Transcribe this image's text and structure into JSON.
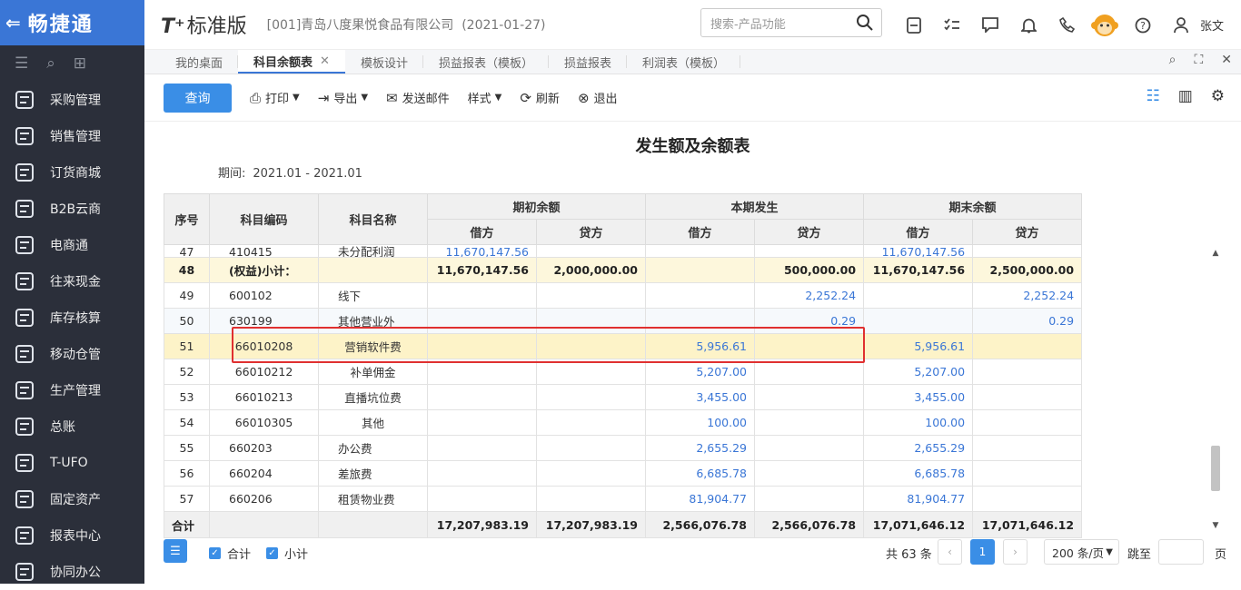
{
  "app": {
    "logo_text": "畅捷通",
    "brand": "T",
    "brand_suffix": "标准版",
    "company": "[001]青岛八度果悦食品有限公司",
    "date": "(2021-01-27)",
    "user": "张文"
  },
  "search": {
    "placeholder": "搜索-产品功能"
  },
  "sidebar": {
    "items": [
      {
        "label": "采购管理",
        "icon": "cart-icon"
      },
      {
        "label": "销售管理",
        "icon": "chart-icon"
      },
      {
        "label": "订货商城",
        "icon": "store-icon"
      },
      {
        "label": "B2B云商",
        "icon": "b2b-icon"
      },
      {
        "label": "电商通",
        "icon": "ecommerce-icon"
      },
      {
        "label": "往来现金",
        "icon": "exchange-icon"
      },
      {
        "label": "库存核算",
        "icon": "warehouse-icon"
      },
      {
        "label": "移动仓管",
        "icon": "mobile-warehouse-icon"
      },
      {
        "label": "生产管理",
        "icon": "production-icon"
      },
      {
        "label": "总账",
        "icon": "ledger-icon"
      },
      {
        "label": "T-UFO",
        "icon": "ufo-icon"
      },
      {
        "label": "固定资产",
        "icon": "bank-icon"
      },
      {
        "label": "报表中心",
        "icon": "report-icon"
      },
      {
        "label": "协同办公",
        "icon": "collab-icon"
      }
    ]
  },
  "tabs": [
    {
      "label": "我的桌面"
    },
    {
      "label": "科目余额表",
      "active": true
    },
    {
      "label": "模板设计"
    },
    {
      "label": "损益报表（模板）"
    },
    {
      "label": "损益报表"
    },
    {
      "label": "利润表（模板）"
    }
  ],
  "toolbar": {
    "query": "查询",
    "print": "打印",
    "export": "导出",
    "email": "发送邮件",
    "style": "样式",
    "refresh": "刷新",
    "exit": "退出"
  },
  "report": {
    "title": "发生额及余额表",
    "period_label": "期间:",
    "period_value": "2021.01 - 2021.01"
  },
  "table": {
    "headers": {
      "seq": "序号",
      "code": "科目编码",
      "name": "科目名称",
      "opening": "期初余额",
      "current": "本期发生",
      "closing": "期末余额",
      "debit": "借方",
      "credit": "贷方"
    },
    "rows": [
      {
        "seq": "47",
        "code": "410415",
        "name": "未分配利润",
        "od": "11,670,147.56",
        "oc": "",
        "cd": "",
        "cc": "",
        "ed": "11,670,147.56",
        "ec": ""
      },
      {
        "seq": "48",
        "code": "(权益)小计：",
        "name": "",
        "od": "11,670,147.56",
        "oc": "2,000,000.00",
        "cd": "",
        "cc": "500,000.00",
        "ed": "11,670,147.56",
        "ec": "2,500,000.00"
      },
      {
        "seq": "49",
        "code": "600102",
        "name": "线下",
        "od": "",
        "oc": "",
        "cd": "",
        "cc": "2,252.24",
        "ed": "",
        "ec": "2,252.24"
      },
      {
        "seq": "50",
        "code": "630199",
        "name": "其他营业外",
        "od": "",
        "oc": "",
        "cd": "",
        "cc": "0.29",
        "ed": "",
        "ec": "0.29"
      },
      {
        "seq": "51",
        "code": "66010208",
        "name": "营销软件费",
        "od": "",
        "oc": "",
        "cd": "5,956.61",
        "cc": "",
        "ed": "5,956.61",
        "ec": ""
      },
      {
        "seq": "52",
        "code": "66010212",
        "name": "补单佣金",
        "od": "",
        "oc": "",
        "cd": "5,207.00",
        "cc": "",
        "ed": "5,207.00",
        "ec": ""
      },
      {
        "seq": "53",
        "code": "66010213",
        "name": "直播坑位费",
        "od": "",
        "oc": "",
        "cd": "3,455.00",
        "cc": "",
        "ed": "3,455.00",
        "ec": ""
      },
      {
        "seq": "54",
        "code": "66010305",
        "name": "其他",
        "od": "",
        "oc": "",
        "cd": "100.00",
        "cc": "",
        "ed": "100.00",
        "ec": ""
      },
      {
        "seq": "55",
        "code": "660203",
        "name": "办公费",
        "od": "",
        "oc": "",
        "cd": "2,655.29",
        "cc": "",
        "ed": "2,655.29",
        "ec": ""
      },
      {
        "seq": "56",
        "code": "660204",
        "name": "差旅费",
        "od": "",
        "oc": "",
        "cd": "6,685.78",
        "cc": "",
        "ed": "6,685.78",
        "ec": ""
      },
      {
        "seq": "57",
        "code": "660206",
        "name": "租赁物业费",
        "od": "",
        "oc": "",
        "cd": "81,904.77",
        "cc": "",
        "ed": "81,904.77",
        "ec": ""
      }
    ],
    "footer": {
      "label": "合计",
      "od": "17,207,983.19",
      "oc": "17,207,983.19",
      "cd": "2,566,076.78",
      "cc": "2,566,076.78",
      "ed": "17,071,646.12",
      "ec": "17,071,646.12"
    }
  },
  "pager": {
    "sum_label": "合计",
    "subtotal_label": "小计",
    "total": "共 63 条",
    "current_page": "1",
    "page_size": "200 条/页",
    "jump_label": "跳至",
    "page_suffix": "页"
  },
  "colors": {
    "accent": "#3a8ee6",
    "sidebar_bg": "#2b2f3a",
    "highlight_box": "#e03030"
  }
}
